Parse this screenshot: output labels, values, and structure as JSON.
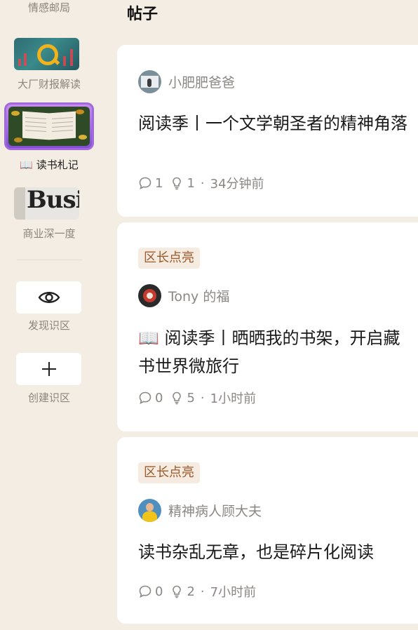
{
  "sidebar": {
    "items": [
      {
        "label": "情感邮局"
      },
      {
        "label": "大厂财报解读"
      },
      {
        "label": "📖 读书札记"
      },
      {
        "label": "商业深一度",
        "thumb_text": "Busi"
      },
      {
        "label": "发现识区",
        "icon": "eye-icon"
      },
      {
        "label": "创建识区",
        "icon": "plus-icon"
      }
    ]
  },
  "main": {
    "title": "帖子",
    "posts": [
      {
        "author": "小肥肥爸爸",
        "title": "阅读季丨一个文学朝圣者的精神角落",
        "comments": "1",
        "likes": "1",
        "time": "34分钟前"
      },
      {
        "badge": "区长点亮",
        "author": "Tony 的福",
        "title_emoji": "📖",
        "title": "阅读季丨晒晒我的书架，开启藏书世界微旅行",
        "comments": "0",
        "likes": "5",
        "time": "1小时前"
      },
      {
        "badge": "区长点亮",
        "author": "精神病人顾大夫",
        "title": "读书杂乱无章，也是碎片化阅读",
        "comments": "0",
        "likes": "2",
        "time": "7小时前"
      }
    ]
  },
  "colors": {
    "background": "#f4ede3",
    "badge_bg": "#f5ebe0",
    "badge_text": "#9a5a2c",
    "selected_border": "#a06ad8"
  }
}
